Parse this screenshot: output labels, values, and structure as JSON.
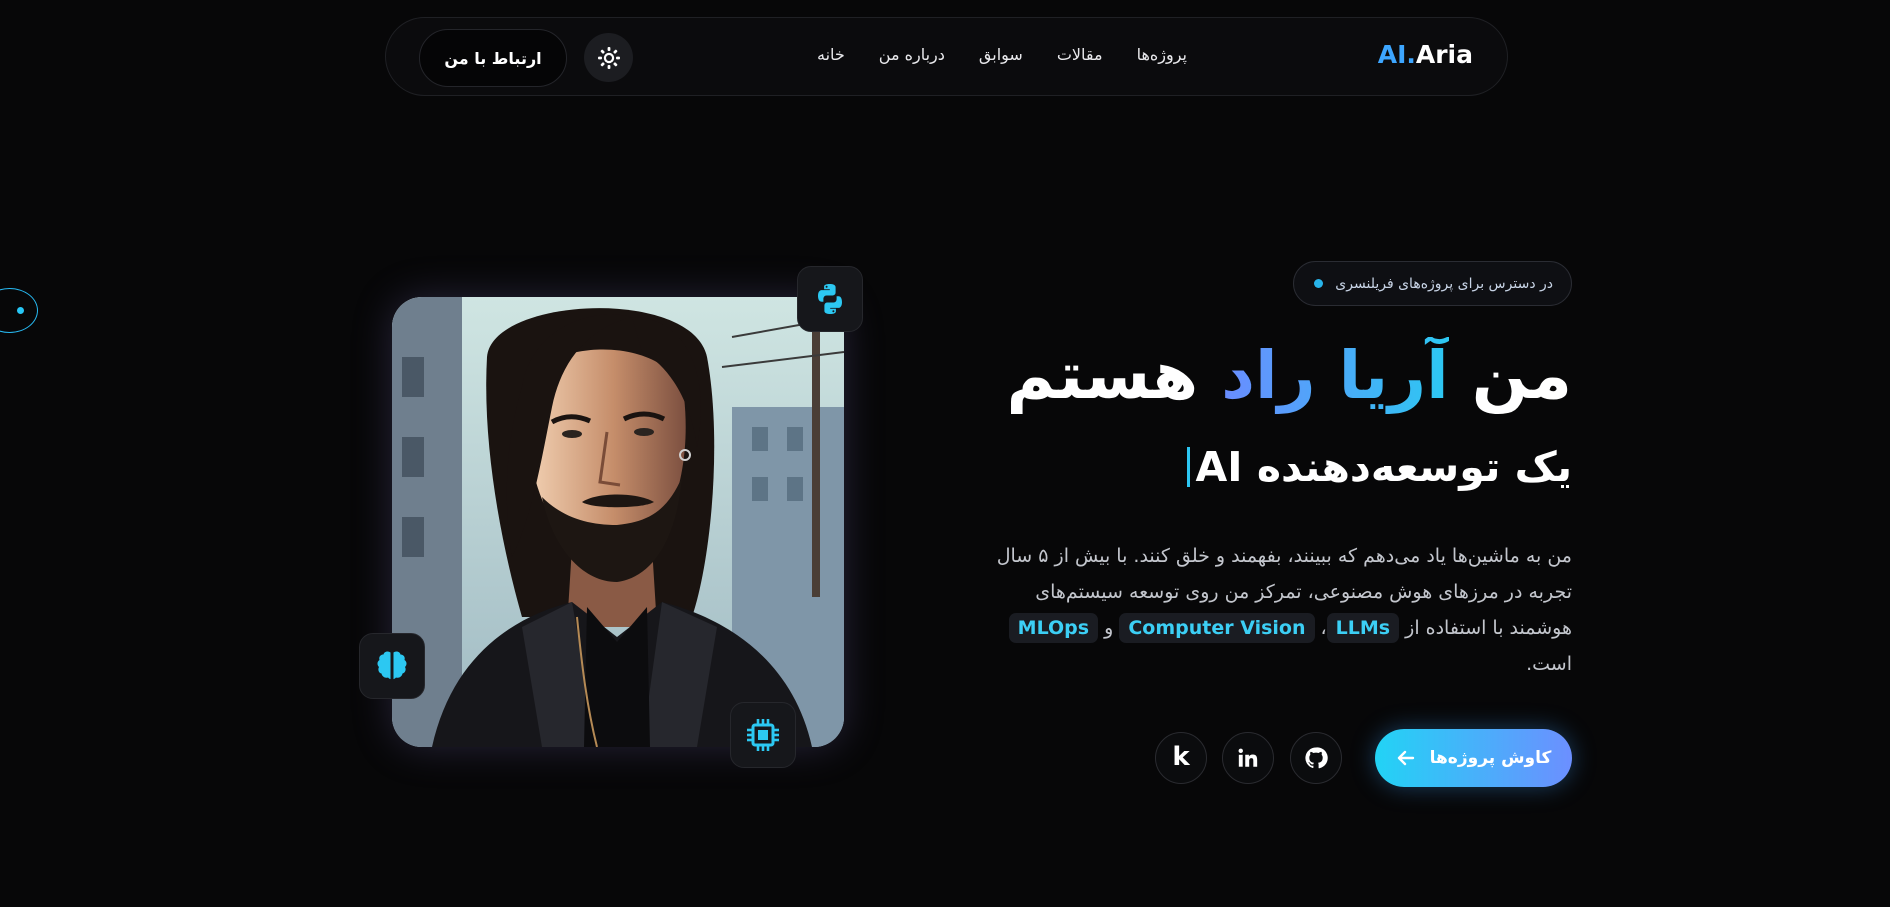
{
  "nav": {
    "logo_ai": "AI.",
    "logo_name": "Aria",
    "links": [
      "خانه",
      "درباره من",
      "سوابق",
      "مقالات",
      "پروژه‌ها"
    ],
    "contact_label": "ارتباط با من",
    "theme_icon": "sun-gear-icon"
  },
  "hero": {
    "badge": "در دسترس برای پروژه‌های فریلنسری",
    "headline_pre": "من ",
    "headline_name": "آریا راد",
    "headline_post": " هستم",
    "subheadline": "یک توسعه‌دهنده AI",
    "description_part1": "من به ماشین‌ها یاد می‌دهم که ببینند، بفهمند و خلق کنند. با بیش از ۵ سال تجربه در مرزهای هوش مصنوعی، تمرکز من روی توسعه سیستم‌های هوشمند با استفاده از ",
    "tag1": "LLMs",
    "sep1": "، ",
    "tag2": "Computer Vision",
    "sep2": " و ",
    "tag3": "MLOps",
    "description_end": " است.",
    "cta_label": "کاوش پروژه‌ها",
    "social": [
      "github-icon",
      "linkedin-icon",
      "kaggle-icon"
    ],
    "social_k_letter": "k"
  },
  "colors": {
    "background": "#070708",
    "accent_cyan": "#2cc8f2",
    "accent_blue": "#6a8cff",
    "logo_blue": "#3da6ff"
  }
}
